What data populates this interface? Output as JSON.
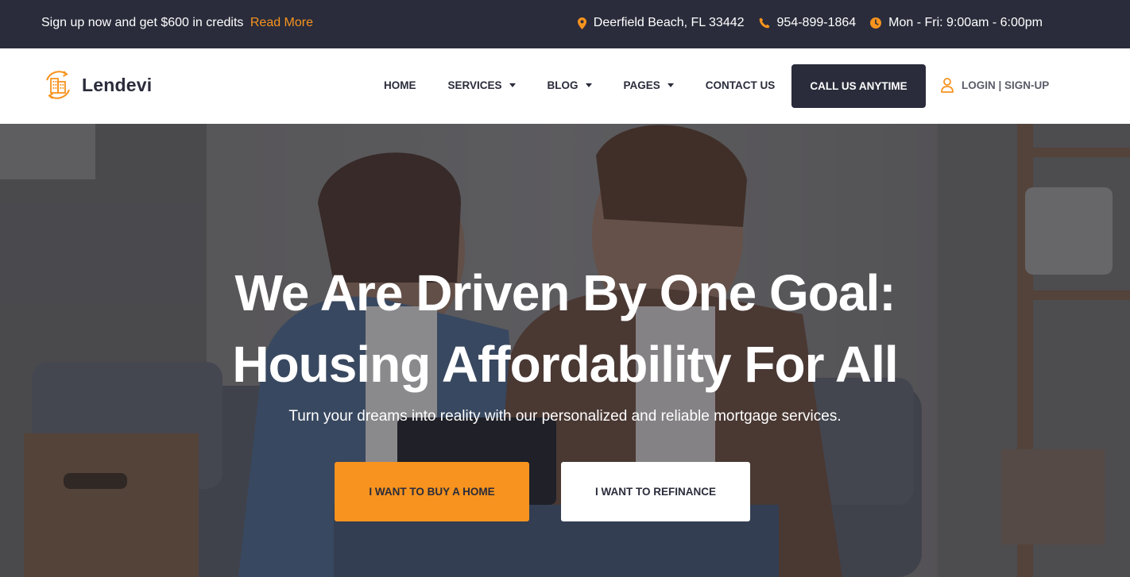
{
  "topbar": {
    "promo_text": "Sign up now and get $600 in credits",
    "promo_link": "Read More",
    "address": "Deerfield Beach, FL 33442",
    "phone": "954-899-1864",
    "hours": "Mon - Fri: 9:00am - 6:00pm",
    "icons": [
      "map-pin-icon",
      "phone-icon",
      "clock-icon"
    ]
  },
  "header": {
    "logo_text": "Lendevi",
    "nav": [
      {
        "label": "HOME",
        "dropdown": false
      },
      {
        "label": "SERVICES",
        "dropdown": true
      },
      {
        "label": "BLOG",
        "dropdown": true
      },
      {
        "label": "PAGES",
        "dropdown": true
      },
      {
        "label": "CONTACT US",
        "dropdown": false
      }
    ],
    "cta_label": "CALL US ANYTIME",
    "login_label": "LOGIN | SIGN-UP"
  },
  "hero": {
    "title_line1": "We Are Driven By One Goal:",
    "title_line2": "Housing Affordability For All",
    "subtitle": "Turn your dreams into reality with our personalized and reliable mortgage services.",
    "btn_buy": "I WANT TO BUY A HOME",
    "btn_refinance": "I WANT TO REFINANCE"
  },
  "colors": {
    "accent": "#f7931e",
    "dark": "#2a2c3b",
    "white": "#ffffff"
  }
}
